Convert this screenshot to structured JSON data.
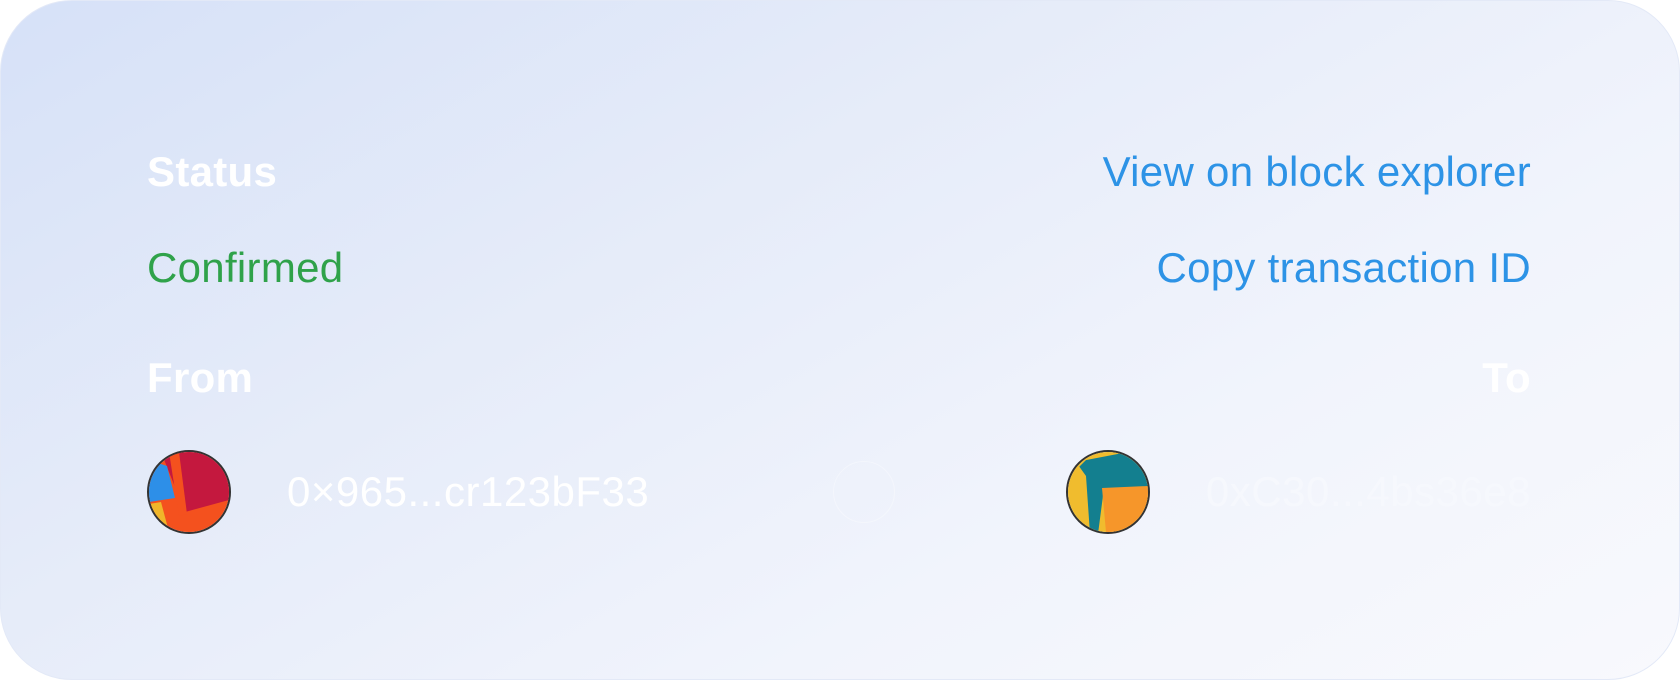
{
  "status": {
    "label": "Status",
    "value": "Confirmed",
    "value_color": "#2fa24a"
  },
  "actions": {
    "view_explorer": "View on block explorer",
    "copy_tx_id": "Copy transaction ID",
    "link_color": "#2d93e6"
  },
  "from": {
    "label": "From",
    "address": "0×965...cr123bF33",
    "avatar_icon": "jazzicon-avatar"
  },
  "to": {
    "label": "To",
    "address": "0xC30...4bs36e8",
    "avatar_icon": "jazzicon-avatar"
  }
}
